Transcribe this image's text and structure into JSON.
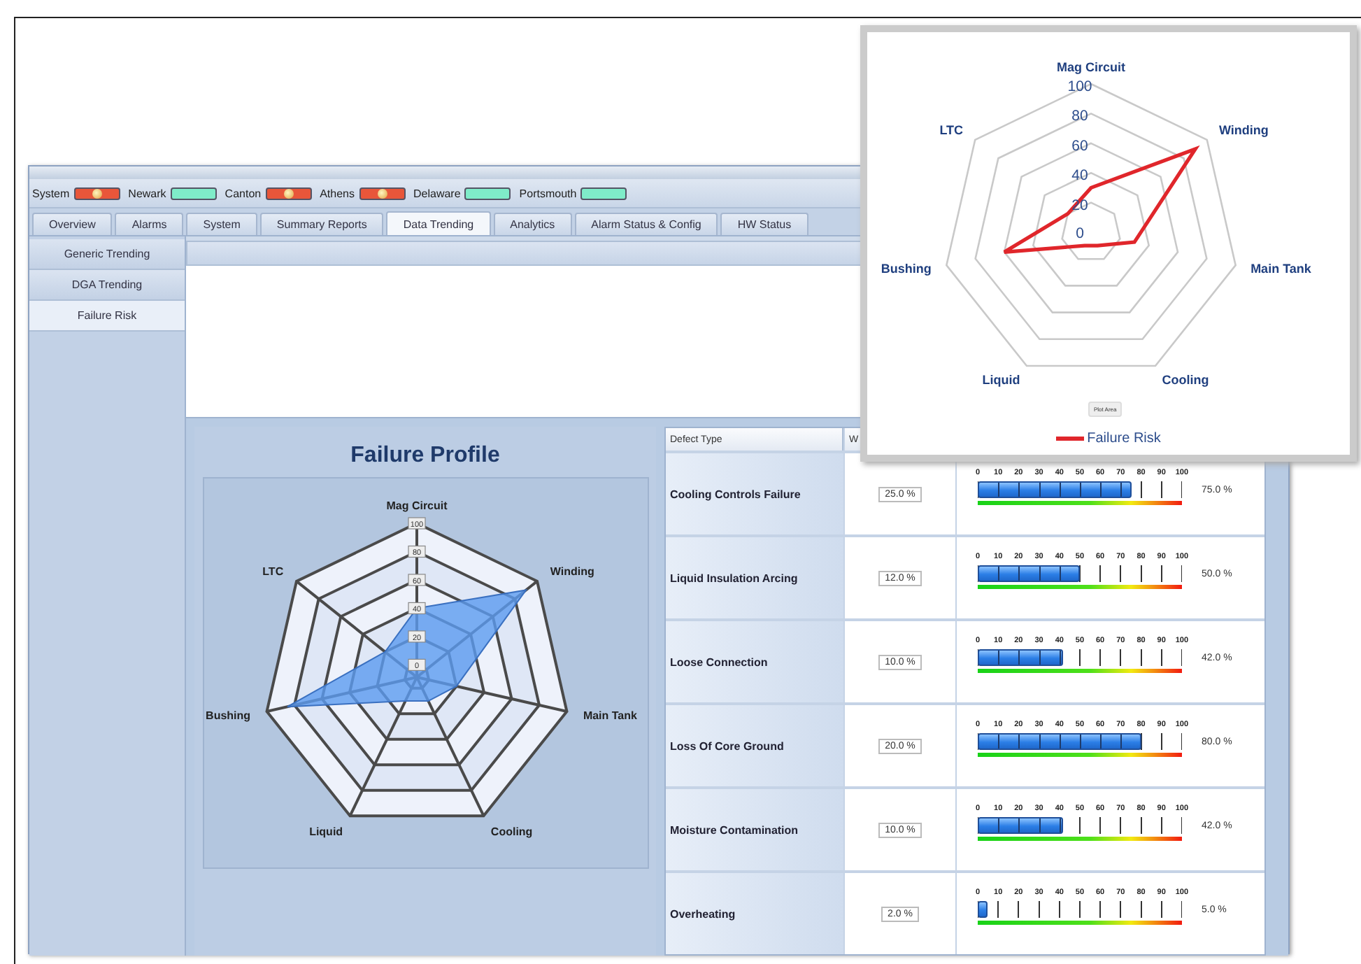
{
  "stations": [
    {
      "name": "System",
      "color": "#e8563a",
      "alarm": true
    },
    {
      "name": "Newark",
      "color": "#7fecc9",
      "alarm": false
    },
    {
      "name": "Canton",
      "color": "#e8563a",
      "alarm": true
    },
    {
      "name": "Athens",
      "color": "#e8563a",
      "alarm": true
    },
    {
      "name": "Delaware",
      "color": "#7fecc9",
      "alarm": false
    },
    {
      "name": "Portsmouth",
      "color": "#7fecc9",
      "alarm": false
    }
  ],
  "tabs": [
    {
      "label": "Overview",
      "selected": false
    },
    {
      "label": "Alarms",
      "selected": false
    },
    {
      "label": "System",
      "selected": false
    },
    {
      "label": "Summary Reports",
      "selected": false
    },
    {
      "label": "Data Trending",
      "selected": true
    },
    {
      "label": "Analytics",
      "selected": false
    },
    {
      "label": "Alarm Status & Config",
      "selected": false
    },
    {
      "label": "HW Status",
      "selected": false
    }
  ],
  "sidebar": {
    "items": [
      {
        "label": "Generic Trending",
        "selected": false
      },
      {
        "label": "DGA Trending",
        "selected": false
      },
      {
        "label": "Failure Risk",
        "selected": true
      }
    ]
  },
  "failure_profile": {
    "title": "Failure Profile",
    "ticks": [
      "100",
      "80",
      "60",
      "40",
      "20",
      "0"
    ],
    "axes": [
      "Mag Circuit",
      "Winding",
      "Main Tank",
      "Cooling",
      "Liquid",
      "Bushing",
      "LTC"
    ]
  },
  "defect_table": {
    "columns": [
      "Defect Type",
      "W"
    ],
    "rows": [
      {
        "defect": "Cooling Controls Failure",
        "weight": "25.0 %",
        "level": 0.75,
        "reading": "75.0 %",
        "scale": [
          "0",
          "10",
          "20",
          "30",
          "40",
          "50",
          "60",
          "70",
          "80",
          "90",
          "100"
        ]
      },
      {
        "defect": "Liquid Insulation Arcing",
        "weight": "12.0 %",
        "level": 0.5,
        "reading": "50.0 %",
        "scale": [
          "0",
          "10",
          "20",
          "30",
          "40",
          "50",
          "60",
          "70",
          "80",
          "90",
          "100"
        ]
      },
      {
        "defect": "Loose Connection",
        "weight": "10.0 %",
        "level": 0.42,
        "reading": "42.0 %",
        "scale": [
          "0",
          "10",
          "20",
          "30",
          "40",
          "50",
          "60",
          "70",
          "80",
          "90",
          "100"
        ]
      },
      {
        "defect": "Loss Of Core Ground",
        "weight": "20.0 %",
        "level": 0.8,
        "reading": "80.0 %",
        "scale": [
          "0",
          "10",
          "20",
          "30",
          "40",
          "50",
          "60",
          "70",
          "80",
          "90",
          "100"
        ]
      },
      {
        "defect": "Moisture Contamination",
        "weight": "10.0 %",
        "level": 0.42,
        "reading": "42.0 %",
        "scale": [
          "0",
          "10",
          "20",
          "30",
          "40",
          "50",
          "60",
          "70",
          "80",
          "90",
          "100"
        ]
      },
      {
        "defect": "Overheating",
        "weight": "2.0 %",
        "level": 0.05,
        "reading": "5.0 %",
        "scale": [
          "0",
          "10",
          "20",
          "30",
          "40",
          "50",
          "60",
          "70",
          "80",
          "90",
          "100"
        ]
      }
    ]
  },
  "inset_chart": {
    "ticks": [
      "100",
      "80",
      "60",
      "40",
      "20",
      "0"
    ],
    "axes": [
      "Mag Circuit",
      "Winding",
      "Main Tank",
      "Cooling",
      "Liquid",
      "Bushing",
      "LTC"
    ],
    "plot_area_tip": "Plot Area",
    "legend": "Failure Risk"
  }
}
